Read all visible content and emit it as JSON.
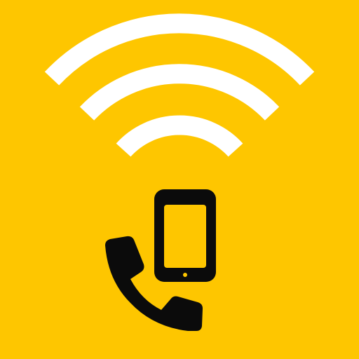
{
  "app_icon": {
    "name": "wifi-calling",
    "colors": {
      "background": "#FEC600",
      "wifi_arcs": "#FFFFFF",
      "phone_outline": "#0B0B0B",
      "handset": "#0B0B0B"
    },
    "icons": [
      "wifi-signal-icon",
      "smartphone-icon",
      "phone-handset-icon"
    ]
  }
}
